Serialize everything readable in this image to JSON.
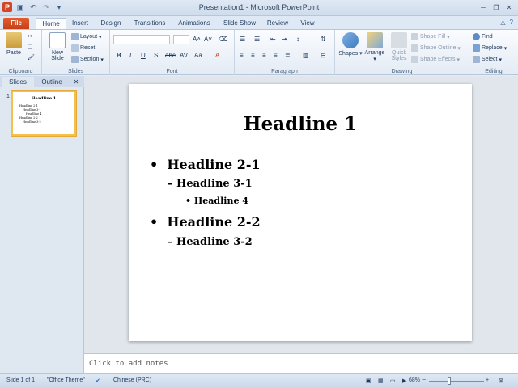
{
  "window": {
    "title": "Presentation1 - Microsoft PowerPoint"
  },
  "quick_access": [
    "powerpoint-logo",
    "save-icon",
    "undo-icon",
    "redo-icon",
    "customize-icon"
  ],
  "tabs": [
    {
      "label": "File"
    },
    {
      "label": "Home"
    },
    {
      "label": "Insert"
    },
    {
      "label": "Design"
    },
    {
      "label": "Transitions"
    },
    {
      "label": "Animations"
    },
    {
      "label": "Slide Show"
    },
    {
      "label": "Review"
    },
    {
      "label": "View"
    }
  ],
  "active_tab": "Home",
  "ribbon": {
    "clipboard": {
      "label": "Clipboard",
      "paste": "Paste"
    },
    "slides": {
      "label": "Slides",
      "new_slide": "New Slide",
      "layout": "Layout",
      "reset": "Reset",
      "section": "Section"
    },
    "font": {
      "label": "Font",
      "font_name": "",
      "font_size": ""
    },
    "paragraph": {
      "label": "Paragraph"
    },
    "drawing": {
      "label": "Drawing",
      "shapes": "Shapes",
      "arrange": "Arrange",
      "quick_styles": "Quick Styles",
      "shape_fill": "Shape Fill",
      "shape_outline": "Shape Outline",
      "shape_effects": "Shape Effects"
    },
    "editing": {
      "label": "Editing",
      "find": "Find",
      "replace": "Replace",
      "select": "Select"
    }
  },
  "panel": {
    "tabs": [
      "Slides",
      "Outline"
    ],
    "thumbnail_number": "1"
  },
  "slide": {
    "title": "Headline 1",
    "bullets": [
      {
        "level": 1,
        "text": "Headline 2-1"
      },
      {
        "level": 2,
        "text": "Headline 3-1"
      },
      {
        "level": 3,
        "text": "Headline 4"
      },
      {
        "level": 1,
        "text": "Headline 2-2"
      },
      {
        "level": 2,
        "text": "Headline 3-2"
      }
    ]
  },
  "notes": {
    "placeholder": "Click to add notes"
  },
  "status_bar": {
    "slide_info": "Slide 1 of 1",
    "theme": "\"Office Theme\"",
    "language": "Chinese (PRC)",
    "zoom": "68%"
  },
  "colors": {
    "file_tab": "#d24726",
    "thumbnail_border": "#f2c14c",
    "ribbon_bg": "#f4f7fb"
  }
}
